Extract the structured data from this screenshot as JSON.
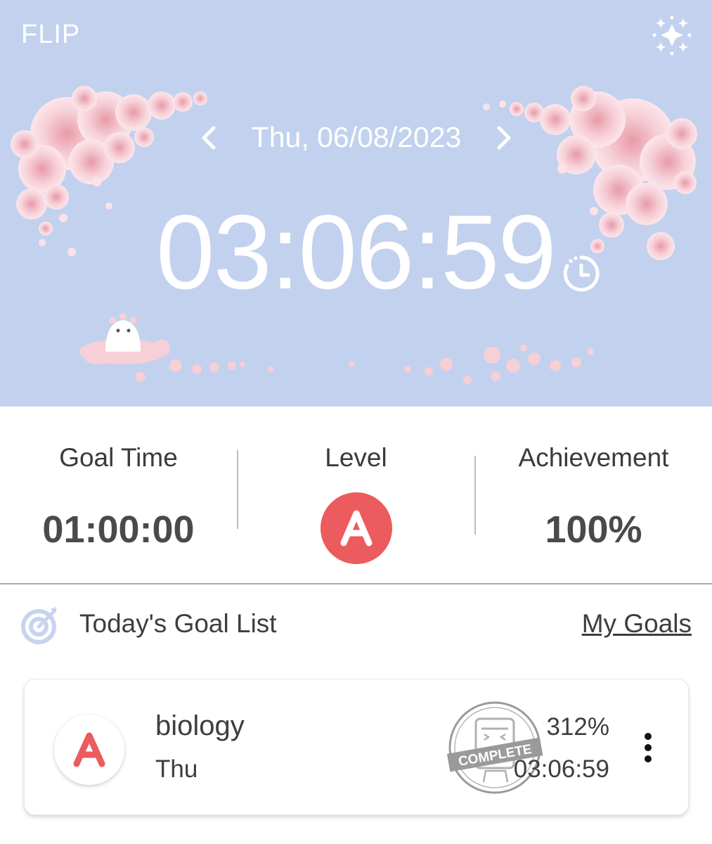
{
  "header": {
    "app_title": "FLIP",
    "date": "Thu, 06/08/2023",
    "timer": "03:06:59",
    "background_color": "#c2d1ee"
  },
  "stats": {
    "goal_time_label": "Goal Time",
    "goal_time_value": "01:00:00",
    "level_label": "Level",
    "level_value": "A",
    "achievement_label": "Achievement",
    "achievement_value": "100%",
    "level_color": "#ec5b5d"
  },
  "goal_list": {
    "title": "Today's Goal List",
    "my_goals_link": "My Goals",
    "items": [
      {
        "level": "A",
        "name": "biology",
        "day": "Thu",
        "stamp_text": "COMPLETE",
        "percent": "312%",
        "time": "03:06:59"
      }
    ]
  },
  "icons": {
    "sparkle": "sparkle-icon",
    "prev": "chevron-left-icon",
    "next": "chevron-right-icon",
    "timer": "timer-history-icon",
    "target": "target-icon",
    "more": "more-vertical-icon"
  }
}
